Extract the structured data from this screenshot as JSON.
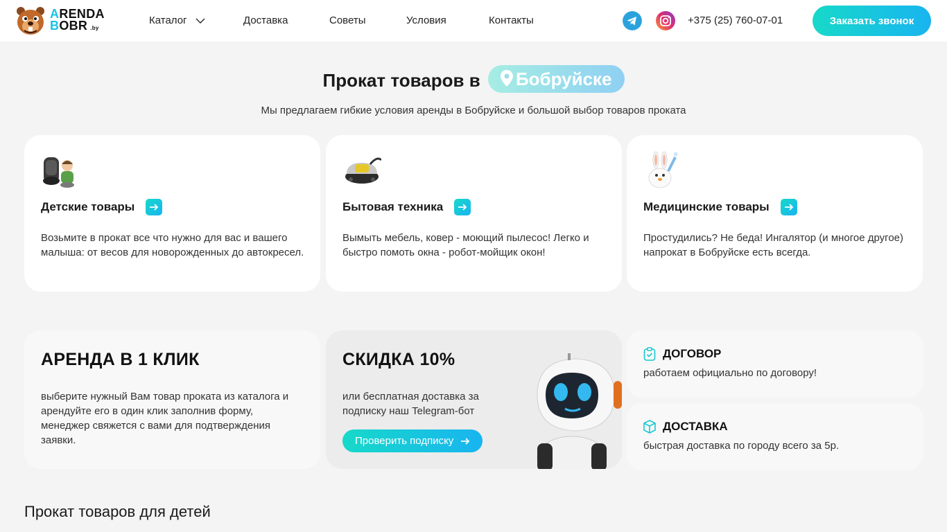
{
  "header": {
    "logo": {
      "line1_a": "A",
      "line1_b": "RENDA",
      "line2_a": "B",
      "line2_b": "OBR",
      "suffix": ".by"
    },
    "nav": [
      {
        "label": "Каталог"
      },
      {
        "label": "Доставка"
      },
      {
        "label": "Советы"
      },
      {
        "label": "Условия"
      },
      {
        "label": "Контакты"
      }
    ],
    "phone": "+375 (25) 760-07-01",
    "call_button": "Заказать звонок"
  },
  "hero": {
    "title": "Прокат товаров в",
    "city": "Бобруйске",
    "subtitle": "Мы предлагаем гибкие условия аренды в Бобруйске и большой выбор товаров проката"
  },
  "categories": [
    {
      "title": "Детские товары",
      "description": "Возьмите в прокат все что нужно для вас и вашего малыша: от весов для новорожденных до автокресел.",
      "icon": "car-seat-icon"
    },
    {
      "title": "Бытовая техника",
      "description": "Вымыть мебель, ковер - моющий пылесос! Легко и быстро помоть окна - робот-мойщик окон!",
      "icon": "vacuum-cleaner-icon"
    },
    {
      "title": "Медицинские товары",
      "description": "Простудились? Не беда! Ингалятор (и многое другое) напрокат в Бобруйске есть всегда.",
      "icon": "inhaler-bunny-icon"
    }
  ],
  "features": {
    "one_click": {
      "title": "АРЕНДА В 1 КЛИК",
      "text": "выберите нужный Вам товар проката из каталога и арендуйте его в один клик заполнив форму, менеджер свяжется с вами для подтверждения заявки."
    },
    "discount": {
      "title": "СКИДКА 10%",
      "text": "или бесплатная доставка за подписку наш Telegram-бот",
      "button": "Проверить подписку"
    },
    "contract": {
      "title": "ДОГОВОР",
      "text": "работаем официально по договору!"
    },
    "delivery": {
      "title": "ДОСТАВКА",
      "text": "быстрая доставка по городу всего за 5р."
    }
  },
  "section": {
    "title": "Прокат товаров для детей"
  },
  "colors": {
    "accent_start": "#17d9c9",
    "accent_end": "#18b4f0",
    "background": "#f4f4f4"
  }
}
